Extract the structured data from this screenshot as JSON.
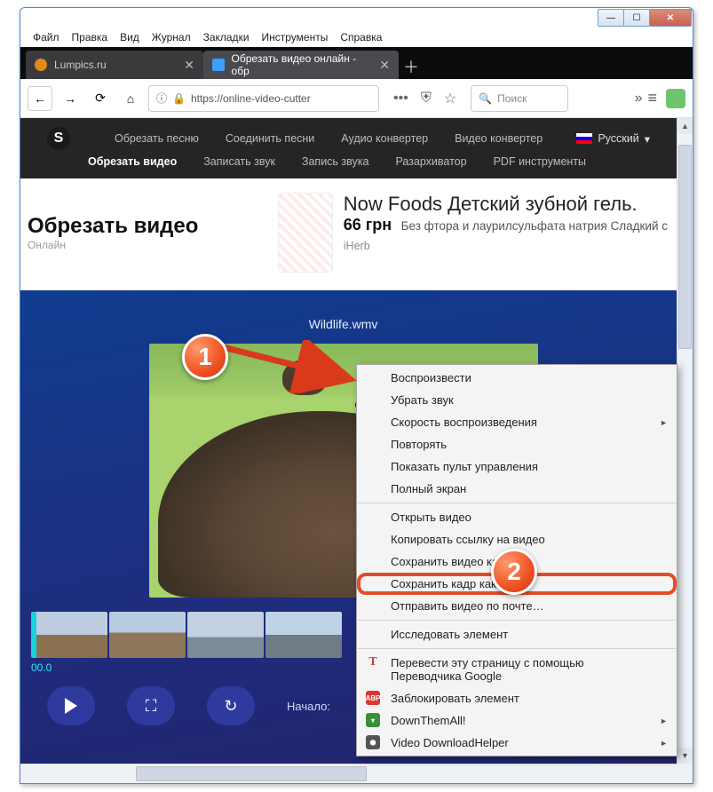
{
  "window": {
    "min": "—",
    "max": "☐",
    "close": "✕"
  },
  "menubar": [
    "Файл",
    "Правка",
    "Вид",
    "Журнал",
    "Закладки",
    "Инструменты",
    "Справка"
  ],
  "tabs": [
    {
      "label": "Lumpics.ru",
      "favicon": "#e08a1a",
      "active": false
    },
    {
      "label": "Обрезать видео онлайн - обр",
      "favicon": "#3aa0ff",
      "active": true
    }
  ],
  "address": {
    "scheme_icon": "ⓘ",
    "lock": "🔒",
    "url": "https://online-video-cutter",
    "search_placeholder": "Поиск"
  },
  "site_nav": {
    "row1": [
      "Обрезать песню",
      "Соединить песни",
      "Аудио конвертер",
      "Видео конвертер"
    ],
    "row2": [
      "Обрезать видео",
      "Записать звук",
      "Запись звука",
      "Разархиватор",
      "PDF инструменты"
    ],
    "active": "Обрезать видео",
    "language": "Русский"
  },
  "page": {
    "title": "Обрезать видео",
    "subtitle": "Онлайн"
  },
  "ad": {
    "title": "Now Foods Детский зубной гель.",
    "price": "66 грн",
    "desc": "Без фтора и лаурилсульфата натрия Сладкий с",
    "merchant": "iHerb"
  },
  "video": {
    "filename": "Wildlife.wmv",
    "time_start": "00.0",
    "start_label": "Начало:"
  },
  "context_menu": {
    "items": [
      {
        "label": "Воспроизвести"
      },
      {
        "label": "Убрать звук"
      },
      {
        "label": "Скорость воспроизведения",
        "sub": true
      },
      {
        "label": "Повторять"
      },
      {
        "label": "Показать пульт управления"
      },
      {
        "label": "Полный экран"
      },
      {
        "sep": true
      },
      {
        "label": "Открыть видео"
      },
      {
        "label": "Копировать ссылку на видео"
      },
      {
        "label": "Сохранить видео как…"
      },
      {
        "label": "Сохранить кадр как…",
        "highlight": true
      },
      {
        "label": "Отправить видео по почте…"
      },
      {
        "sep": true
      },
      {
        "label": "Исследовать элемент"
      },
      {
        "sep": true
      },
      {
        "label": "Перевести эту страницу с помощью Переводчика Google",
        "icon": "T",
        "icon_color": "#d33"
      },
      {
        "label": "Заблокировать элемент",
        "icon": "ABP",
        "icon_bg": "#d33"
      },
      {
        "label": "DownThemAll!",
        "icon": "▾",
        "icon_bg": "#3a8f3a",
        "sub": true
      },
      {
        "label": "Video DownloadHelper",
        "icon": "⬢",
        "icon_bg": "#555",
        "sub": true
      }
    ]
  },
  "badges": {
    "one": "1",
    "two": "2"
  }
}
